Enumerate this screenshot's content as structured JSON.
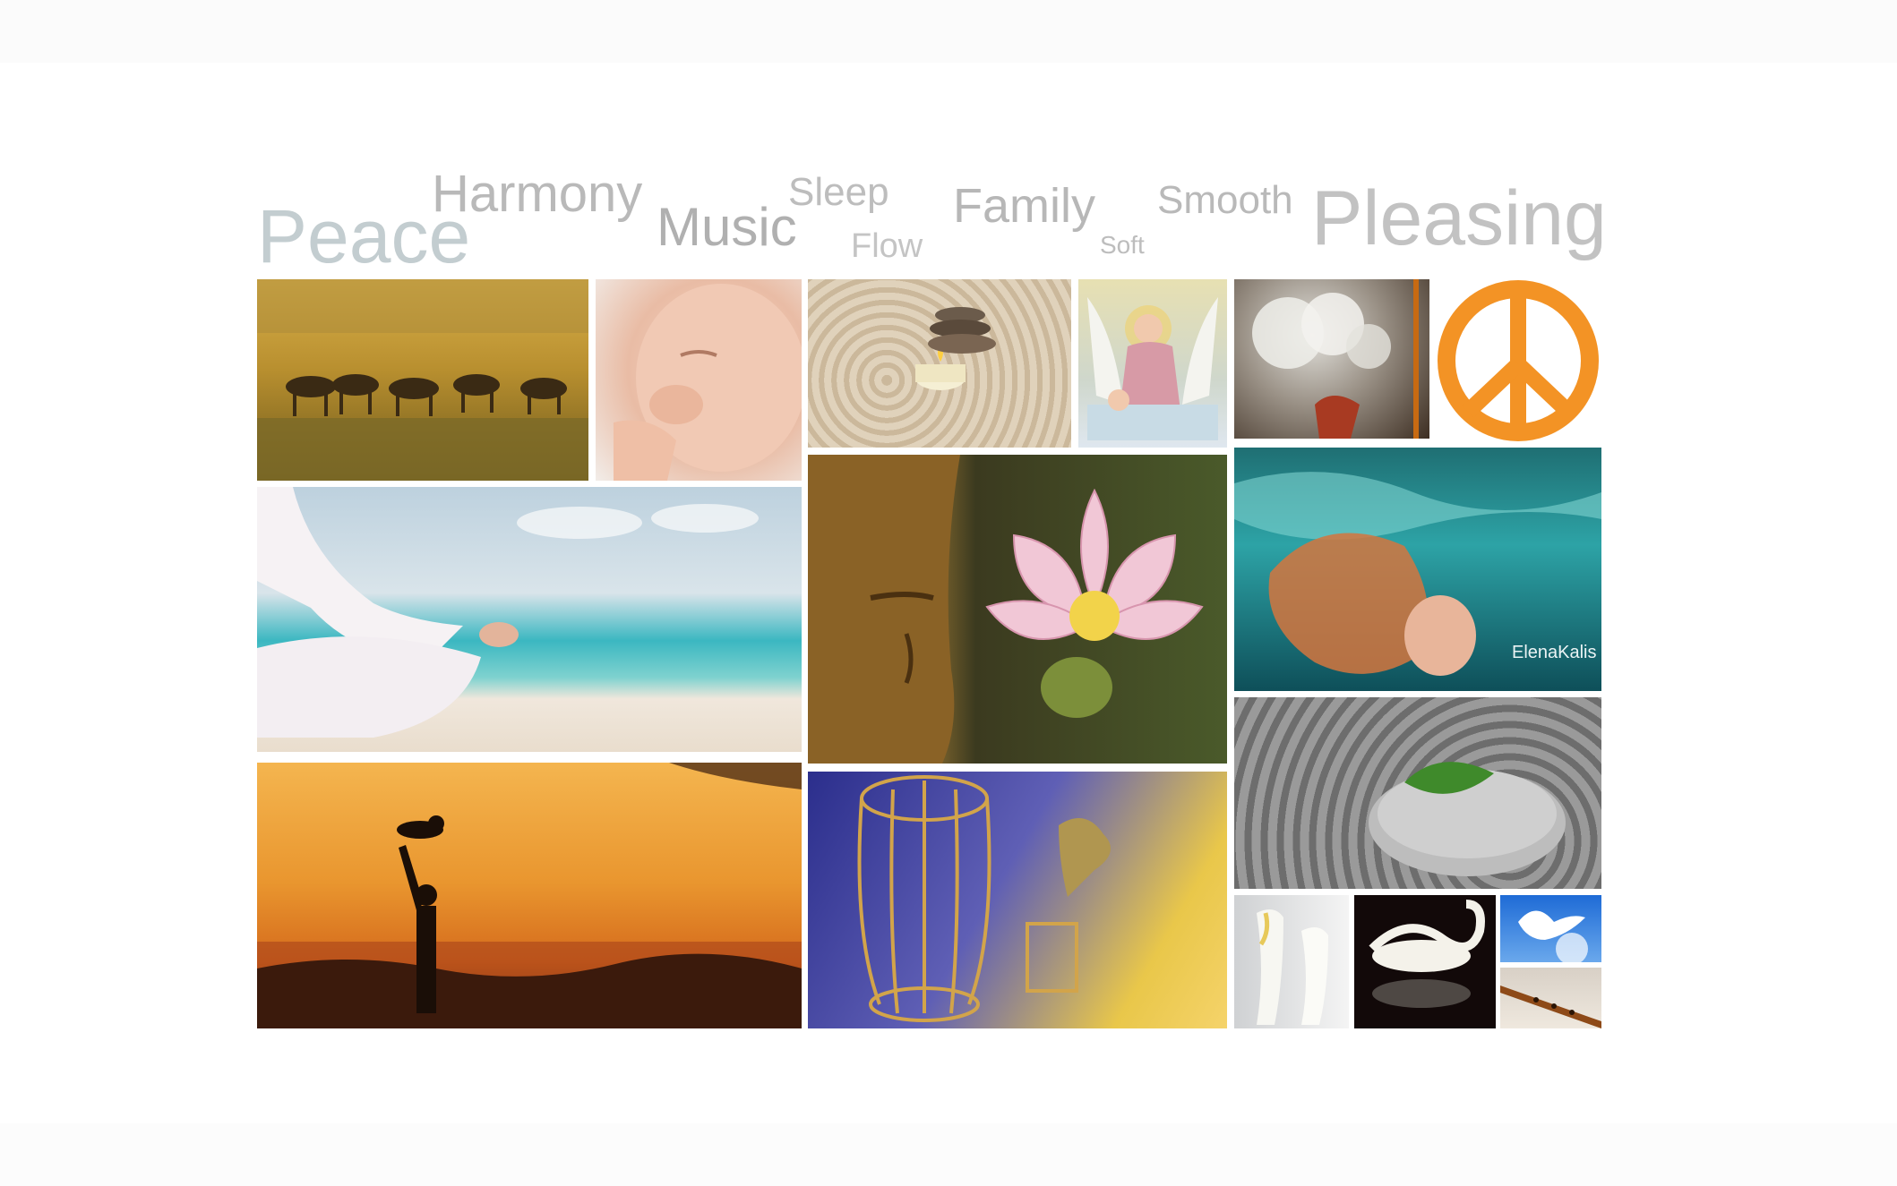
{
  "words": {
    "peace": "Peace",
    "harmony": "Harmony",
    "music": "Music",
    "sleep": "Sleep",
    "flow": "Flow",
    "family": "Family",
    "soft": "Soft",
    "smooth": "Smooth",
    "pleasing": "Pleasing"
  },
  "watermarks": {
    "water_photo": "ElenaKalis"
  },
  "colors": {
    "word_gray": "#b4b4b4",
    "peace_sign_orange": "#f39325"
  }
}
